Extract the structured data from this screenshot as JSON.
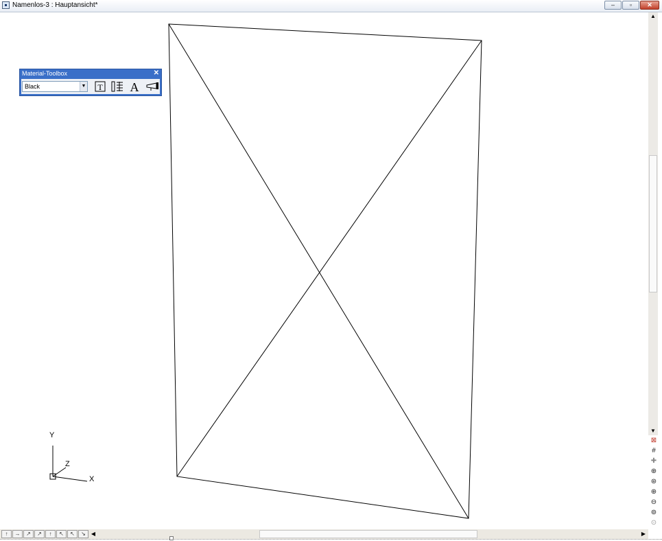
{
  "window": {
    "title": "Namenlos-3 : Hauptansicht*"
  },
  "toolbox": {
    "title": "Material-Toolbox",
    "close_glyph": "✕",
    "material": "Black",
    "icons": [
      "texture-icon",
      "layer-list-icon",
      "text-icon",
      "paint-bucket-icon"
    ]
  },
  "axes": {
    "x": "X",
    "y": "Y",
    "z": "Z"
  },
  "colors": {
    "toolbox_title": "#3a6fc8",
    "close_button": "#c2412b"
  }
}
